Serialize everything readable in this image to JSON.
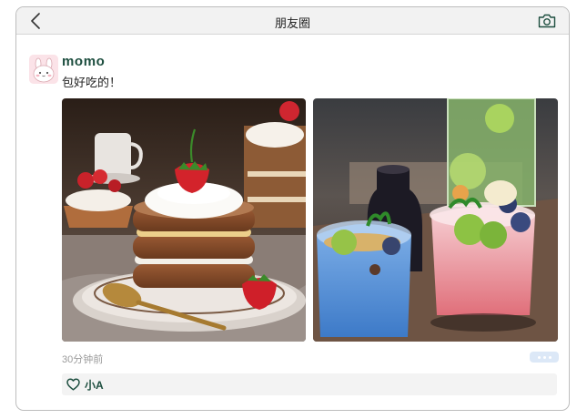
{
  "header": {
    "title": "朋友圈",
    "back_icon": "chevron-left-icon",
    "camera_icon": "camera-icon"
  },
  "post": {
    "username": "momo",
    "text": "包好吃的！",
    "timestamp": "30分钟前",
    "photos": [
      {
        "subject": "layered-strawberry-cake"
      },
      {
        "subject": "fruit-dessert-drinks"
      }
    ],
    "likes": {
      "icon": "heart-icon",
      "users": [
        "小A"
      ]
    }
  },
  "colors": {
    "name_accent": "#1d4e3f",
    "more_button": "#dce8f7",
    "likes_background": "#f3f3f3"
  }
}
